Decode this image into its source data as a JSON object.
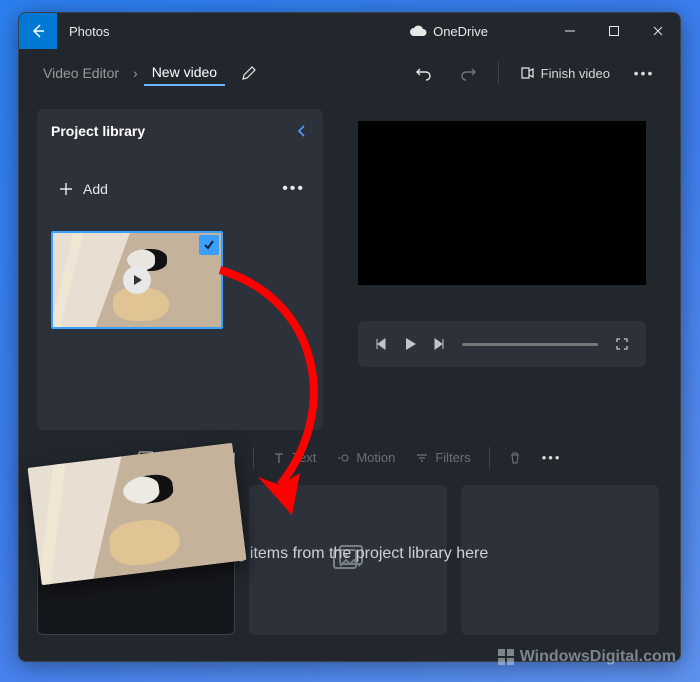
{
  "titlebar": {
    "appName": "Photos",
    "cloud": "OneDrive"
  },
  "breadcrumb": {
    "root": "Video Editor",
    "current": "New video"
  },
  "actions": {
    "finish": "Finish video"
  },
  "library": {
    "title": "Project library",
    "add": "Add"
  },
  "toolbar": {
    "titleCard": "Add title card",
    "text": "Text",
    "motion": "Motion",
    "filters": "Filters"
  },
  "storyboard": {
    "dropHint": "Drag items from the project library here"
  },
  "watermark": {
    "text": "WindowsDigital.com"
  }
}
